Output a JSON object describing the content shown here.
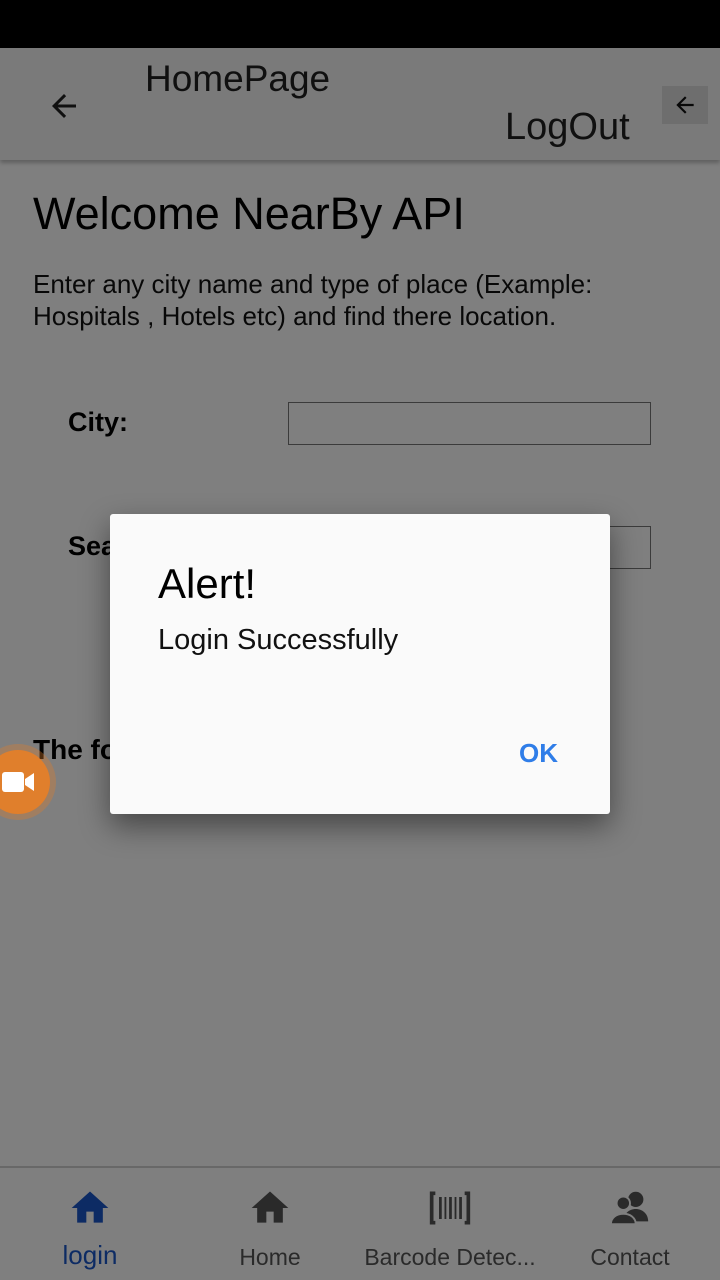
{
  "app_bar": {
    "title": "HomePage",
    "logout_label": "LogOut"
  },
  "main": {
    "heading": "Welcome NearBy API",
    "intro": "Enter any city name and type of place (Example: Hospitals , Hotels etc) and find there location.",
    "city_label": "City:",
    "city_value": "",
    "search_label": "Sea",
    "search_value": "",
    "result_label": "The fo"
  },
  "dialog": {
    "title": "Alert!",
    "message": "Login Successfully",
    "ok_label": "OK"
  },
  "bottom_nav": {
    "items": [
      {
        "label": "login",
        "icon": "home-icon",
        "active": true
      },
      {
        "label": "Home",
        "icon": "home-icon",
        "active": false
      },
      {
        "label": "Barcode Detec...",
        "icon": "barcode-icon",
        "active": false
      },
      {
        "label": "Contact",
        "icon": "contacts-icon",
        "active": false
      }
    ]
  },
  "colors": {
    "accent": "#1a56c9",
    "dialog_button": "#2f7de8",
    "fab": "#e07f2c",
    "scrim": "rgba(0,0,0,0.5)"
  }
}
